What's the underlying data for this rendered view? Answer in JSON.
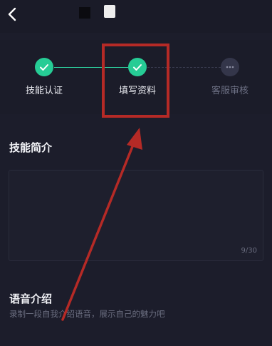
{
  "steps": [
    {
      "label": "技能认证",
      "state": "done"
    },
    {
      "label": "填写资料",
      "state": "done"
    },
    {
      "label": "客服审核",
      "state": "todo"
    }
  ],
  "skill_intro": {
    "title": "技能简介",
    "counter": "9/30"
  },
  "voice_intro": {
    "title": "语音介绍",
    "description": "录制一段自我介绍语音，展示自己的魅力吧"
  },
  "icons": {
    "back": "chevron-left-icon",
    "check": "check-icon",
    "more": "more-dots-icon"
  },
  "colors": {
    "background": "#1c1d2b",
    "accent": "#26cc95",
    "annotation": "#b52a26"
  }
}
